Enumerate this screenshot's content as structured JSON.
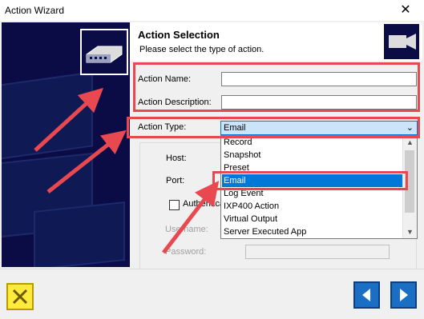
{
  "window": {
    "title": "Action Wizard"
  },
  "header": {
    "title": "Action Selection",
    "subtitle": "Please select the type of action."
  },
  "form": {
    "action_name_label": "Action Name:",
    "action_name_value": "",
    "action_description_label": "Action Description:",
    "action_description_value": "",
    "action_type_label": "Action Type:",
    "action_type_value": "Email",
    "host_label": "Host:",
    "port_label": "Port:",
    "authentication_label": "Authentication",
    "username_label": "Username:",
    "password_label": "Password:"
  },
  "dropdown": {
    "options": [
      "Record",
      "Snapshot",
      "Preset",
      "Email",
      "Log Event",
      "IXP400 Action",
      "Virtual Output",
      "Server Executed App"
    ],
    "selected": "Email"
  },
  "colors": {
    "annotation": "#e8484f",
    "accent": "#0078d7",
    "panel": "#0b0b46"
  },
  "icons": {
    "close": "close-icon",
    "cancel": "x-icon",
    "back": "arrow-left-icon",
    "next": "arrow-right-icon"
  }
}
